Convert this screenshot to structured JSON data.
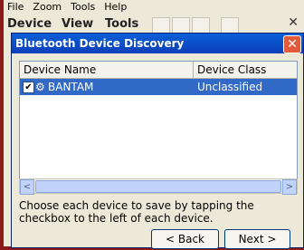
{
  "app": {
    "menu": [
      "File",
      "Zoom",
      "Tools",
      "Help"
    ],
    "toolbar": {
      "items": [
        "Device",
        "View",
        "Tools"
      ]
    }
  },
  "dialog": {
    "title": "Bluetooth Device Discovery",
    "list": {
      "columns": [
        "Device Name",
        "Device Class"
      ],
      "rows": [
        {
          "checked": true,
          "name": "BANTAM",
          "class": "Unclassified",
          "icon": "bluetooth-device-icon"
        }
      ]
    },
    "instructions": "Choose each device to save by tapping the checkbox to the left of each device.",
    "buttons": {
      "back": "< Back",
      "next": "Next >"
    },
    "colors": {
      "title_bar": "#0b4fcf",
      "selection": "#3169c6",
      "close": "#e35a3a",
      "background": "#ece9d8"
    }
  }
}
